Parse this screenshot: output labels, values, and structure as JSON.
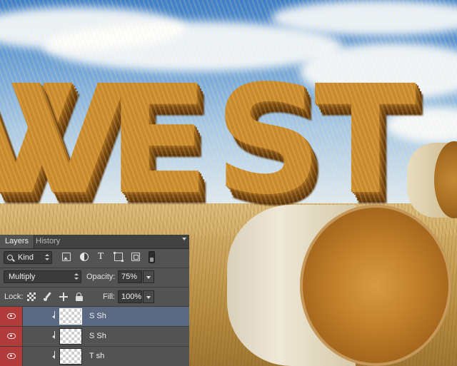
{
  "canvas": {
    "headline_letters": [
      "V",
      "E",
      "S",
      "T"
    ]
  },
  "layers_panel": {
    "tabs": [
      {
        "label": "Layers",
        "active": true
      },
      {
        "label": "History",
        "active": false
      }
    ],
    "filter": {
      "kind_label": "Kind",
      "icons": [
        "image-filter-icon",
        "adjustment-filter-icon",
        "type-filter-icon",
        "shape-filter-icon",
        "smart-object-filter-icon",
        "filter-toggle-icon"
      ]
    },
    "blend_mode": "Multiply",
    "opacity_label": "Opacity:",
    "opacity_value": "75%",
    "lock_label": "Lock:",
    "lock_icons": [
      "lock-transparent-icon",
      "lock-image-icon",
      "lock-position-icon",
      "lock-all-icon"
    ],
    "fill_label": "Fill:",
    "fill_value": "100%",
    "layers": [
      {
        "name": "S Sh",
        "selected": true,
        "visible": true,
        "clipped": true
      },
      {
        "name": "S Sh",
        "selected": false,
        "visible": true,
        "clipped": true
      },
      {
        "name": "T sh",
        "selected": false,
        "visible": true,
        "clipped": true
      }
    ]
  },
  "colors": {
    "panel_bg": "#535353",
    "selected_layer": "#5b6a82",
    "eye_cell": "#b23b3b",
    "hay": "#c98a2c"
  }
}
